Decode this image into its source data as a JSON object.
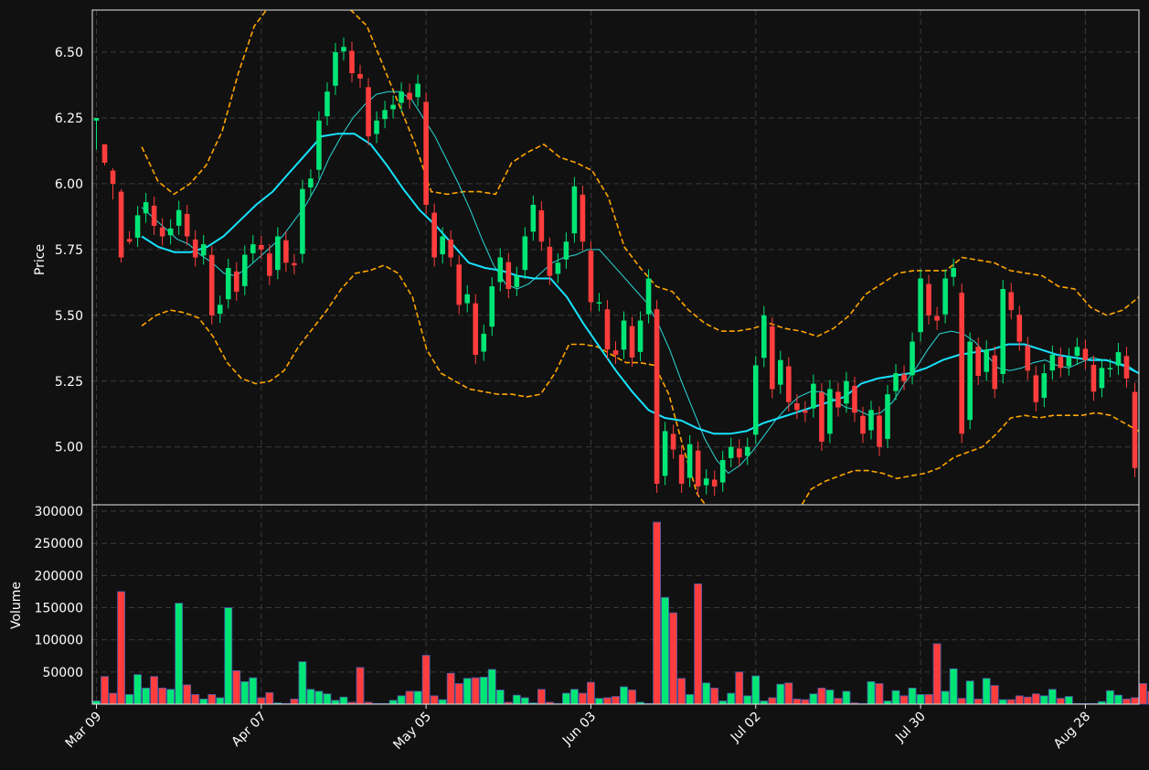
{
  "chart_data": {
    "type": "candlestick",
    "price_axis": {
      "label": "Price",
      "ylim": [
        4.78,
        6.66
      ],
      "ticks": [
        5.0,
        5.25,
        5.5,
        5.75,
        6.0,
        6.25,
        6.5
      ]
    },
    "volume_axis": {
      "label": "Volume",
      "ylim": [
        0,
        310000
      ],
      "ticks": [
        50000,
        100000,
        150000,
        200000,
        250000,
        300000
      ]
    },
    "x_tick_labels": [
      "Mar 09",
      "Apr 07",
      "May 05",
      "Jun 03",
      "Jul 02",
      "Jul 30",
      "Aug 28"
    ],
    "x_tick_indices": [
      0,
      20,
      40,
      60,
      80,
      100,
      120
    ],
    "grid": true,
    "colors": {
      "up": "#00e676",
      "down": "#ff3d3d",
      "ma_fast": "#2ad9d9",
      "ma_slow": "#17e3ff",
      "bands": "#ffa500",
      "background": "#111111",
      "grid": "#3a3a3a"
    },
    "closes": [
      6.25,
      6.08,
      6.0,
      5.72,
      5.78,
      5.88,
      5.93,
      5.84,
      5.8,
      5.83,
      5.9,
      5.8,
      5.72,
      5.77,
      5.5,
      5.54,
      5.68,
      5.59,
      5.73,
      5.77,
      5.75,
      5.65,
      5.8,
      5.7,
      5.69,
      5.98,
      6.02,
      6.24,
      6.35,
      6.5,
      6.52,
      6.42,
      6.4,
      6.18,
      6.24,
      6.28,
      6.3,
      6.35,
      6.32,
      6.38,
      5.92,
      5.72,
      5.8,
      5.72,
      5.54,
      5.58,
      5.35,
      5.43,
      5.61,
      5.72,
      5.6,
      5.65,
      5.8,
      5.92,
      5.78,
      5.65,
      5.7,
      5.78,
      5.99,
      5.78,
      5.55,
      5.55,
      5.37,
      5.35,
      5.48,
      5.34,
      5.48,
      5.64,
      4.86,
      5.06,
      4.99,
      4.86,
      5.01,
      4.85,
      4.88,
      4.85,
      4.95,
      5.0,
      4.96,
      5.0,
      5.31,
      5.5,
      5.22,
      5.33,
      5.17,
      5.14,
      5.13,
      5.24,
      5.02,
      5.22,
      5.15,
      5.25,
      5.13,
      5.05,
      5.14,
      5.0,
      5.2,
      5.28,
      5.25,
      5.4,
      5.64,
      5.5,
      5.48,
      5.64,
      5.68,
      5.05,
      5.4,
      5.27,
      5.37,
      5.22,
      5.6,
      5.52,
      5.4,
      5.29,
      5.17,
      5.28,
      5.35,
      5.3,
      5.34,
      5.38,
      5.33,
      5.21,
      5.3,
      5.3,
      5.36,
      5.26,
      4.92
    ],
    "candles_ohlc_sample": [
      [
        6.24,
        6.25,
        6.13,
        6.25
      ],
      [
        6.15,
        6.15,
        6.07,
        6.08
      ],
      [
        6.05,
        6.06,
        5.94,
        6.0
      ],
      [
        5.97,
        5.98,
        5.7,
        5.72
      ],
      [
        5.79,
        5.82,
        5.77,
        5.78
      ]
    ],
    "ma_fast": [
      5.91,
      5.87,
      5.83,
      5.79,
      5.77,
      5.73,
      5.7,
      5.66,
      5.65,
      5.68,
      5.72,
      5.76,
      5.8,
      5.86,
      5.92,
      6.0,
      6.1,
      6.18,
      6.25,
      6.3,
      6.34,
      6.35,
      6.35,
      6.32,
      6.25,
      6.18,
      6.09,
      6.0,
      5.9,
      5.79,
      5.69,
      5.62,
      5.6,
      5.62,
      5.66,
      5.7,
      5.72,
      5.73,
      5.75,
      5.75,
      5.7,
      5.65,
      5.6,
      5.55,
      5.47,
      5.37,
      5.25,
      5.14,
      5.03,
      4.95,
      4.9,
      4.93,
      4.98,
      5.04,
      5.1,
      5.15,
      5.19,
      5.21,
      5.21,
      5.18,
      5.15,
      5.14,
      5.12,
      5.13,
      5.17,
      5.24,
      5.3,
      5.37,
      5.43,
      5.44,
      5.43,
      5.4,
      5.35,
      5.3,
      5.29,
      5.3,
      5.32,
      5.33,
      5.31,
      5.3,
      5.32,
      5.34,
      5.33,
      5.32,
      5.31,
      5.28
    ],
    "ma_slow": [
      5.8,
      5.76,
      5.74,
      5.74,
      5.76,
      5.8,
      5.86,
      5.92,
      5.97,
      6.04,
      6.11,
      6.18,
      6.19,
      6.19,
      6.15,
      6.07,
      5.98,
      5.9,
      5.84,
      5.77,
      5.7,
      5.68,
      5.67,
      5.65,
      5.64,
      5.64,
      5.57,
      5.47,
      5.38,
      5.29,
      5.21,
      5.14,
      5.11,
      5.1,
      5.07,
      5.05,
      5.05,
      5.06,
      5.09,
      5.11,
      5.13,
      5.15,
      5.17,
      5.19,
      5.24,
      5.26,
      5.27,
      5.28,
      5.3,
      5.33,
      5.35,
      5.36,
      5.37,
      5.39,
      5.39,
      5.37,
      5.35,
      5.34,
      5.33,
      5.33,
      5.31,
      5.28
    ],
    "upper_band": [
      6.14,
      6.01,
      5.96,
      6.0,
      6.07,
      6.2,
      6.42,
      6.6,
      6.68,
      6.7,
      6.72,
      6.72,
      6.7,
      6.66,
      6.6,
      6.45,
      6.3,
      6.15,
      5.97,
      5.96,
      5.97,
      5.97,
      5.96,
      6.08,
      6.12,
      6.15,
      6.1,
      6.08,
      6.05,
      5.95,
      5.76,
      5.68,
      5.61,
      5.59,
      5.52,
      5.47,
      5.44,
      5.44,
      5.45,
      5.47,
      5.45,
      5.44,
      5.42,
      5.45,
      5.5,
      5.58,
      5.62,
      5.66,
      5.67,
      5.67,
      5.67,
      5.72,
      5.71,
      5.7,
      5.67,
      5.66,
      5.65,
      5.61,
      5.6,
      5.53,
      5.5,
      5.52,
      5.57
    ],
    "lower_band": [
      5.46,
      5.5,
      5.52,
      5.51,
      5.49,
      5.42,
      5.32,
      5.26,
      5.24,
      5.25,
      5.29,
      5.38,
      5.45,
      5.52,
      5.6,
      5.66,
      5.67,
      5.69,
      5.66,
      5.57,
      5.37,
      5.28,
      5.25,
      5.22,
      5.21,
      5.2,
      5.2,
      5.19,
      5.2,
      5.28,
      5.39,
      5.39,
      5.38,
      5.35,
      5.32,
      5.32,
      5.31,
      5.2,
      5.0,
      4.82,
      4.75,
      4.6,
      4.45,
      4.2,
      4.4,
      4.6,
      4.75,
      4.84,
      4.87,
      4.89,
      4.91,
      4.91,
      4.9,
      4.88,
      4.89,
      4.9,
      4.92,
      4.96,
      4.98,
      5.0,
      5.05,
      5.11,
      5.12,
      5.11,
      5.12,
      5.12,
      5.12,
      5.13,
      5.12,
      5.09,
      5.06
    ],
    "volumes": [
      5000,
      43000,
      17000,
      175000,
      15000,
      46000,
      25000,
      43000,
      25000,
      23000,
      157000,
      30000,
      15000,
      8000,
      15000,
      10000,
      150000,
      52000,
      35000,
      41000,
      10000,
      18000,
      2000,
      1000,
      8000,
      66000,
      23000,
      20000,
      16000,
      6000,
      11000,
      3000,
      57000,
      3000,
      1000,
      1000,
      6000,
      13000,
      20000,
      20000,
      76000,
      13000,
      7000,
      48000,
      32000,
      40000,
      41000,
      42000,
      54000,
      22000,
      3000,
      14000,
      10000,
      2000,
      23000,
      3000,
      1000,
      17000,
      23000,
      17000,
      34000,
      9000,
      10000,
      12000,
      27000,
      22000,
      3000,
      1000,
      283000,
      166000,
      142000,
      40000,
      15000,
      187000,
      33000,
      25000,
      5000,
      17000,
      50000,
      13000,
      44000,
      5000,
      10000,
      31000,
      33000,
      8000,
      7000,
      16000,
      25000,
      22000,
      9000,
      20000,
      2000,
      1000,
      35000,
      32000,
      5000,
      21000,
      13000,
      25000,
      15000,
      15000,
      94000,
      20000,
      55000,
      9000,
      36000,
      8000,
      40000,
      29000,
      7000,
      7000,
      13000,
      11000,
      16000,
      13000,
      23000,
      9000,
      12000,
      1000,
      1000,
      1000,
      4000,
      21000,
      14000,
      8000,
      10000,
      32000,
      20000
    ]
  }
}
